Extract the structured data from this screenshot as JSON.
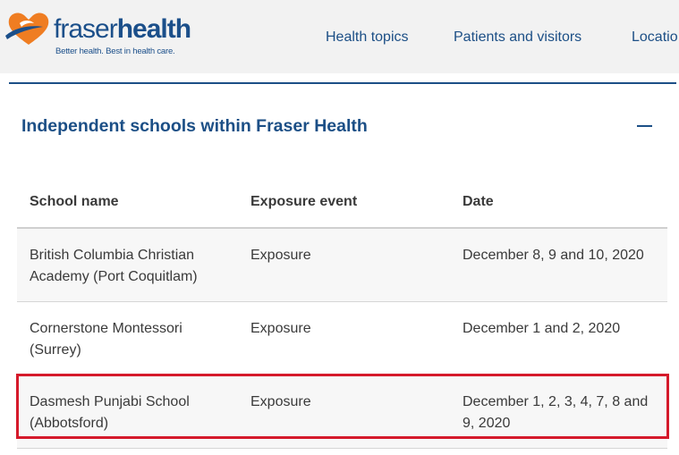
{
  "header": {
    "logo": {
      "word_light": "fraser",
      "word_bold": "health",
      "tagline": "Better health. Best in health care."
    },
    "nav": [
      {
        "label": "Health topics"
      },
      {
        "label": "Patients and visitors"
      },
      {
        "label": "Locatio"
      }
    ]
  },
  "section": {
    "title": "Independent schools within Fraser Health",
    "toggle": "collapse"
  },
  "table": {
    "columns": [
      "School name",
      "Exposure event",
      "Date"
    ],
    "rows": [
      {
        "school": "British Columbia Christian Academy (Port Coquitlam)",
        "event": "Exposure",
        "date": "December 8, 9 and 10, 2020"
      },
      {
        "school": "Cornerstone Montessori (Surrey)",
        "event": "Exposure",
        "date": "December 1 and 2, 2020"
      },
      {
        "school": "Dasmesh Punjabi School (Abbotsford)",
        "event": "Exposure",
        "date": "December 1, 2, 3, 4, 7, 8 and 9, 2020"
      }
    ],
    "highlighted_row": 2
  },
  "colors": {
    "brand_blue": "#1c4f86",
    "logo_orange": "#ef7d22",
    "highlight_red": "#d51a2b",
    "header_bg": "#f2f2f2"
  }
}
